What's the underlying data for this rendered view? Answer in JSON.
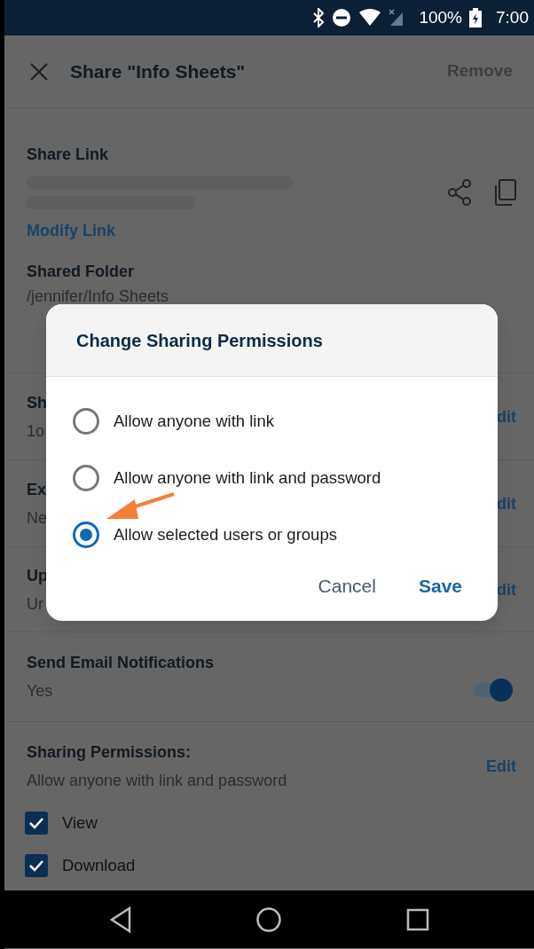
{
  "status_bar": {
    "battery": "100%",
    "time": "7:00"
  },
  "app_bar": {
    "title": "Share \"Info Sheets\"",
    "action": "Remove"
  },
  "share_link": {
    "label": "Share Link",
    "modify": "Modify Link"
  },
  "shared_folder": {
    "label": "Shared Folder",
    "path": "/jennifer/Info Sheets"
  },
  "covered_rows": [
    {
      "label": "Sh",
      "value": "1o",
      "action": "dit"
    },
    {
      "label": "Ex",
      "value": "Ne",
      "action": "dit"
    },
    {
      "label": "Up",
      "value": "Ur",
      "action": "dit"
    }
  ],
  "email": {
    "label": "Send Email Notifications",
    "value": "Yes",
    "on": true
  },
  "permissions": {
    "label": "Sharing Permissions:",
    "value": "Allow anyone with link and password",
    "action": "Edit",
    "options": [
      {
        "label": "View",
        "checked": true
      },
      {
        "label": "Download",
        "checked": true
      }
    ]
  },
  "dialog": {
    "title": "Change Sharing Permissions",
    "options": [
      {
        "label": "Allow anyone with link",
        "selected": false
      },
      {
        "label": "Allow anyone with link and password",
        "selected": false
      },
      {
        "label": "Allow selected users or groups",
        "selected": true
      }
    ],
    "buttons": [
      {
        "label": "Cancel",
        "kind": "secondary"
      },
      {
        "label": "Save",
        "kind": "primary"
      }
    ]
  }
}
